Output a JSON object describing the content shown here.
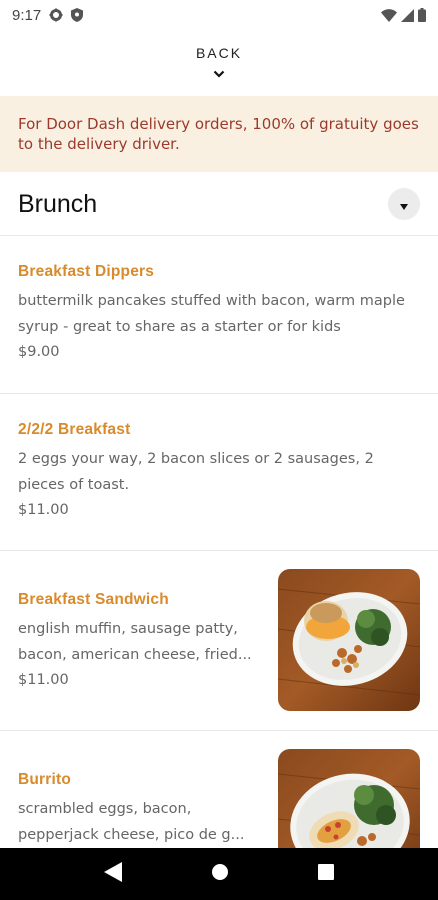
{
  "status_bar": {
    "time": "9:17",
    "left_icons": [
      "gear-icon",
      "shield-icon"
    ],
    "right_icons": [
      "wifi-icon",
      "cellular-signal-icon",
      "battery-icon"
    ]
  },
  "header": {
    "back_label": "BACK",
    "back_icon": "chevron-down-icon"
  },
  "notice": {
    "text": "For Door Dash delivery orders, 100% of gratuity goes to the delivery driver."
  },
  "section": {
    "title": "Brunch",
    "toggle_icon": "caret-down-icon"
  },
  "menu_items": [
    {
      "name": "Breakfast Dippers",
      "description": "buttermilk pancakes stuffed with bacon, warm maple syrup - great to share as a starter or for kids",
      "price": "$9.00",
      "has_photo": false
    },
    {
      "name": "2/2/2 Breakfast",
      "description": "2 eggs your way, 2 bacon slices or 2 sausages, 2 pieces of toast.",
      "price": "$11.00",
      "has_photo": false
    },
    {
      "name": "Breakfast Sandwich",
      "description_line1": "english muffin, sausage patty,",
      "description_line2": "bacon, american cheese, fried...",
      "price": "$11.00",
      "has_photo": true
    },
    {
      "name": "Burrito",
      "description_line1": "scrambled eggs, bacon,",
      "description_line2": "pepperjack cheese, pico de g...",
      "has_photo": true
    }
  ],
  "nav_bar": {
    "icons": [
      "back-triangle-icon",
      "home-circle-icon",
      "recents-square-icon"
    ]
  },
  "colors": {
    "accent": "#d98a2b",
    "notice_bg": "#faf0e1",
    "notice_text": "#9b3a2c"
  }
}
